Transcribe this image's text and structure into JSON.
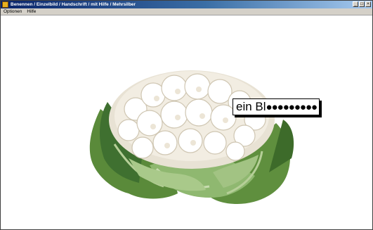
{
  "window": {
    "title": "Benennen / Einzelbild / Handschrift / mit Hilfe / Mehrsilber"
  },
  "menu": {
    "items": [
      "Optionen",
      "Hilfe"
    ]
  },
  "exercise": {
    "image": "cauliflower",
    "answer_typed": "ein Bl",
    "answer_hidden": "●●●●●●●●●"
  },
  "colors": {
    "titlebar_start": "#0a246a",
    "titlebar_end": "#a6caf0",
    "menubar": "#d4d0c8"
  }
}
